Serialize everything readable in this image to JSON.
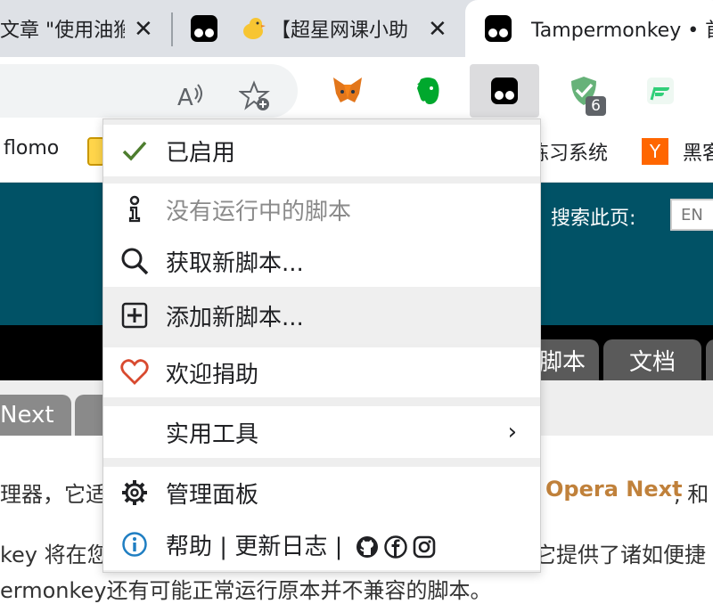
{
  "tabs": [
    {
      "title": "文章 \"使用油猴",
      "close": "✕"
    },
    {
      "title": "【超星网课小助",
      "close": "✕"
    },
    {
      "title": "Tampermonkey • 首"
    }
  ],
  "toolbar": {
    "read_aloud_icon": "read-aloud-icon",
    "favorite_icon": "add-favorite-icon",
    "extensions": [
      {
        "name": "metamask"
      },
      {
        "name": "evernote"
      },
      {
        "name": "tampermonkey"
      },
      {
        "name": "adguard",
        "badge": "6"
      },
      {
        "name": "flomo"
      }
    ]
  },
  "bookmarks": {
    "items": [
      "flomo",
      "练习系统",
      "黑客"
    ],
    "y_icon": "Y"
  },
  "page": {
    "search_label": "搜索此页:",
    "search_value": "EN",
    "nav_tabs": [
      "脚本",
      "文档"
    ],
    "sub_tabs": [
      "Next"
    ],
    "lines": {
      "line1_left": "理器，它适",
      "line1_highlight": "Opera Next",
      "line1_right": ", 和",
      "line2_left": "key 将在您",
      "line2_right": "它提供了诸如便捷",
      "line3": "ermonkey还有可能正常运行原本并不兼容的脚本。"
    }
  },
  "menu": {
    "enabled": "已启用",
    "no_scripts": "没有运行中的脚本",
    "get_new": "获取新脚本...",
    "add_new": "添加新脚本...",
    "donate": "欢迎捐助",
    "utilities": "实用工具",
    "dashboard": "管理面板",
    "help": "帮助",
    "sep": "|",
    "changelog": "更新日志",
    "chevron": "›"
  },
  "colors": {
    "header_bg": "#015266",
    "check": "#4d7d2e",
    "heart": "#d84a2f",
    "info": "#1f7ec2",
    "highlight": "#c0813b"
  }
}
